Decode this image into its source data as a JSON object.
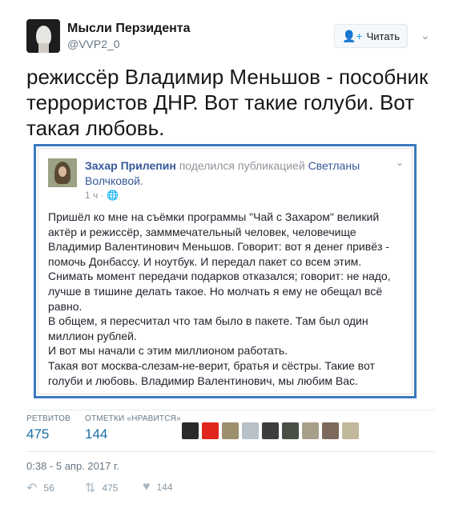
{
  "tweet": {
    "author_name": "Мысли Перзидента",
    "handle": "@VVP2_0",
    "follow_label": "Читать",
    "text": "режиссёр Владимир Меньшов - пособник террористов ДНР. Вот такие голуби. Вот такая любовь.",
    "timestamp": "0:38 - 5 апр. 2017 г."
  },
  "embed": {
    "author": "Захар Прилепин",
    "shared_text": "поделился публикацией",
    "source": "Светланы Волчковой.",
    "time": "1 ч ·",
    "paragraphs": [
      "Пришёл ко мне на съёмки программы \"Чай с Захаром\" великий актёр и режиссёр, замммечательный человек, человечище Владимир Валентинович Меньшов. Говорит: вот я денег привёз - помочь Донбассу. И ноутбук. И передал пакет со всем этим.",
      "Снимать момент передачи подарков отказался; говорит: не надо, лучше в тишине делать такое. Но молчать я ему не обещал всё равно.",
      "В общем, я пересчитал что там было в пакете. Там был один миллион рублей.",
      "И вот мы начали с этим миллионом работать.",
      "Такая вот москва-слезам-не-верит, братья и сёстры. Такие вот голуби и любовь. Владимир Валентинович, мы любим Вас."
    ]
  },
  "stats": {
    "retweets_label": "РЕТВИТОВ",
    "retweets_value": "475",
    "likes_label": "ОТМЕТКИ «НРАВИТСЯ»",
    "likes_value": "144"
  },
  "liker_avatar_colors": [
    "#2b2b2b",
    "#e0261d",
    "#9c8f6e",
    "#b8c0c8",
    "#3d3d3d",
    "#4a4f45",
    "#a89f8a",
    "#7d6a5c",
    "#c2b89c"
  ],
  "actions": {
    "reply_count": "56",
    "retweet_count": "475",
    "like_count": "144"
  },
  "icons": [
    "user-plus-icon",
    "chevron-down-icon",
    "globe-icon",
    "reply-icon",
    "retweet-icon",
    "heart-icon"
  ]
}
